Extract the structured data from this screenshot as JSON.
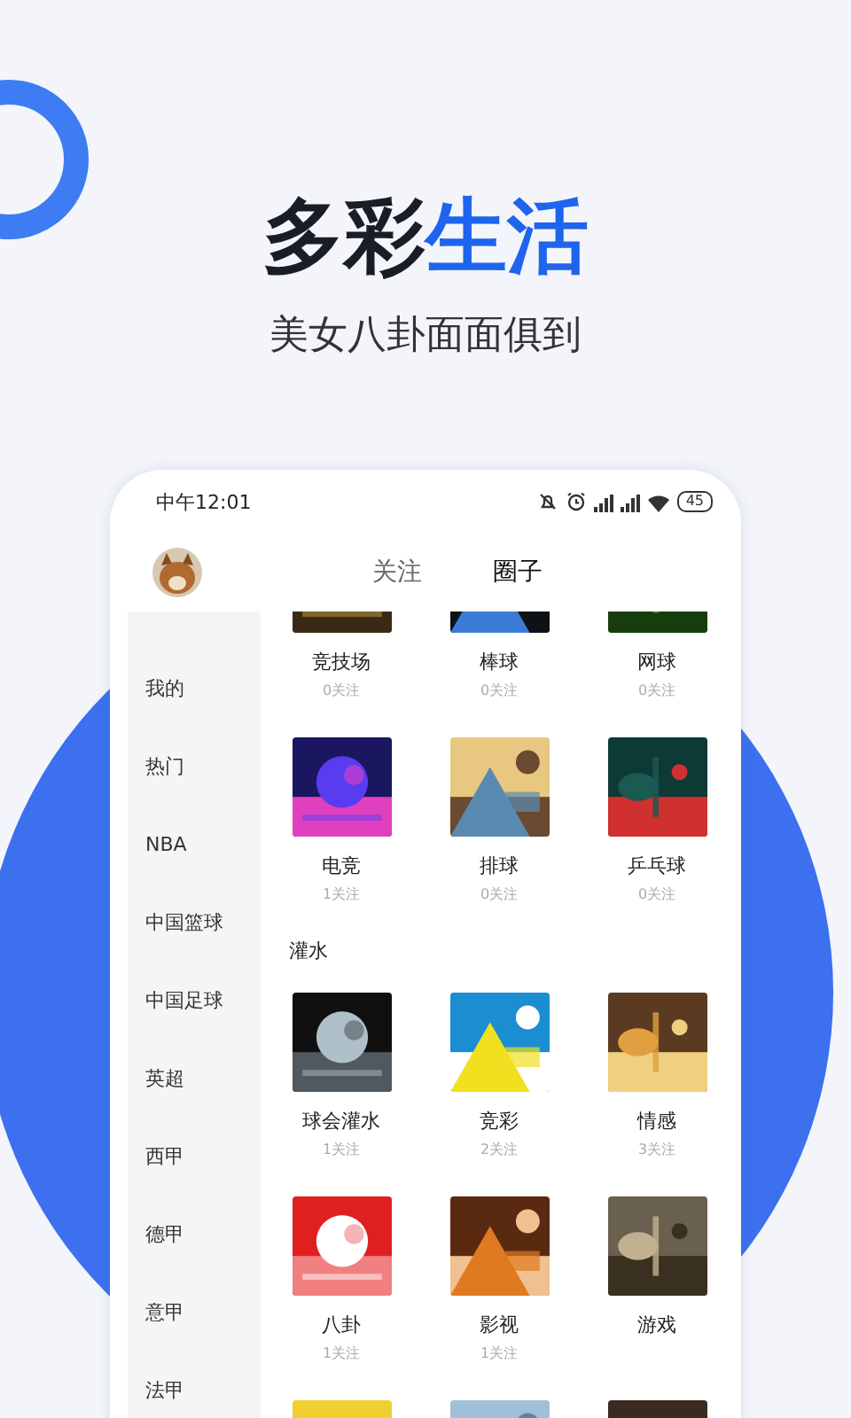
{
  "headline": [
    {
      "text": "多彩",
      "kind": "plain"
    },
    {
      "text": "生活",
      "kind": "accent"
    }
  ],
  "tagline": "美女八卦面面俱到",
  "phone": {
    "status_bar": {
      "time": "中午12:01",
      "battery": "45"
    },
    "avatar": {
      "kind": "picture"
    },
    "tabs": [
      {
        "label": "关注",
        "selected": false
      },
      {
        "label": "圈子",
        "selected": true
      }
    ],
    "sidebar": {
      "items": [
        {
          "label": "我的"
        },
        {
          "label": "热门"
        },
        {
          "label": "NBA"
        },
        {
          "label": "中国篮球"
        },
        {
          "label": "中国足球"
        },
        {
          "label": "英超"
        },
        {
          "label": "西甲"
        },
        {
          "label": "德甲"
        },
        {
          "label": "意甲"
        },
        {
          "label": "法甲"
        }
      ]
    },
    "sections": [
      {
        "tiles": [
          {
            "name": "竞技场",
            "followers": "0关注",
            "kind": "picture"
          },
          {
            "name": "棒球",
            "followers": "0关注",
            "kind": "picture"
          },
          {
            "name": "网球",
            "followers": "0关注",
            "kind": "picture"
          },
          {
            "name": "电竞",
            "followers": "1关注",
            "kind": "picture"
          },
          {
            "name": "排球",
            "followers": "0关注",
            "kind": "picture"
          },
          {
            "name": "乒乓球",
            "followers": "0关注",
            "kind": "picture"
          }
        ]
      },
      {
        "title": "灌水",
        "tiles": [
          {
            "name": "球会灌水",
            "followers": "1关注",
            "kind": "picture"
          },
          {
            "name": "竞彩",
            "followers": "2关注",
            "kind": "picture"
          },
          {
            "name": "情感",
            "followers": "3关注",
            "kind": "picture"
          },
          {
            "name": "八卦",
            "followers": "1关注",
            "kind": "picture"
          },
          {
            "name": "影视",
            "followers": "1关注",
            "kind": "picture"
          },
          {
            "name": "游戏",
            "kind": "picture"
          },
          {
            "kind": "picture"
          },
          {
            "kind": "picture"
          },
          {
            "kind": "picture"
          }
        ]
      }
    ]
  }
}
